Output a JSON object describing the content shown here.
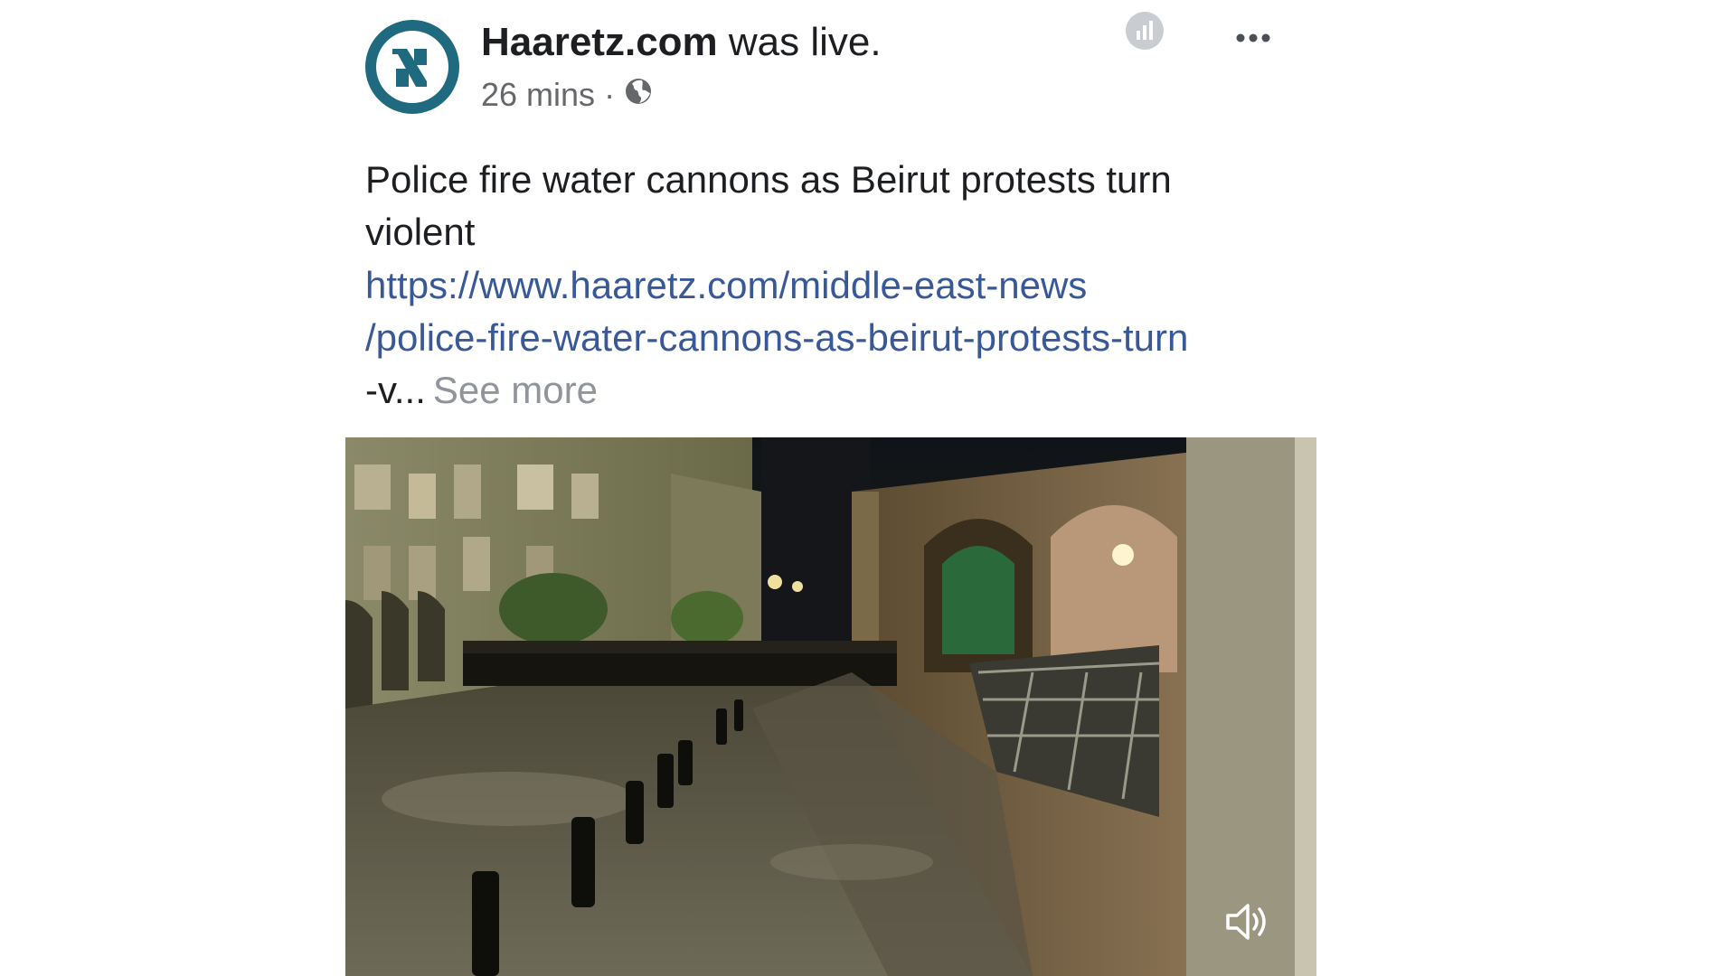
{
  "post": {
    "page_name": "Haaretz.com",
    "action_text": " was live.",
    "time": "26 mins",
    "separator": "·",
    "privacy_icon": "globe-icon",
    "stats_icon": "bar-chart-icon",
    "more_icon": "ellipsis-icon",
    "title": "Police fire water cannons as Beirut protests turn violent",
    "link_line_1": "https://www.haaretz.com/middle-east-news",
    "link_line_2": "/police-fire-water-cannons-as-beirut-protests-turn",
    "link_line_3": "-v...",
    "see_more": "See more",
    "video_volume_icon": "volume-icon"
  },
  "colors": {
    "avatar_ring": "#1f6a7f",
    "link": "#385898",
    "muted_text": "#65676b",
    "see_more": "#90949c"
  }
}
